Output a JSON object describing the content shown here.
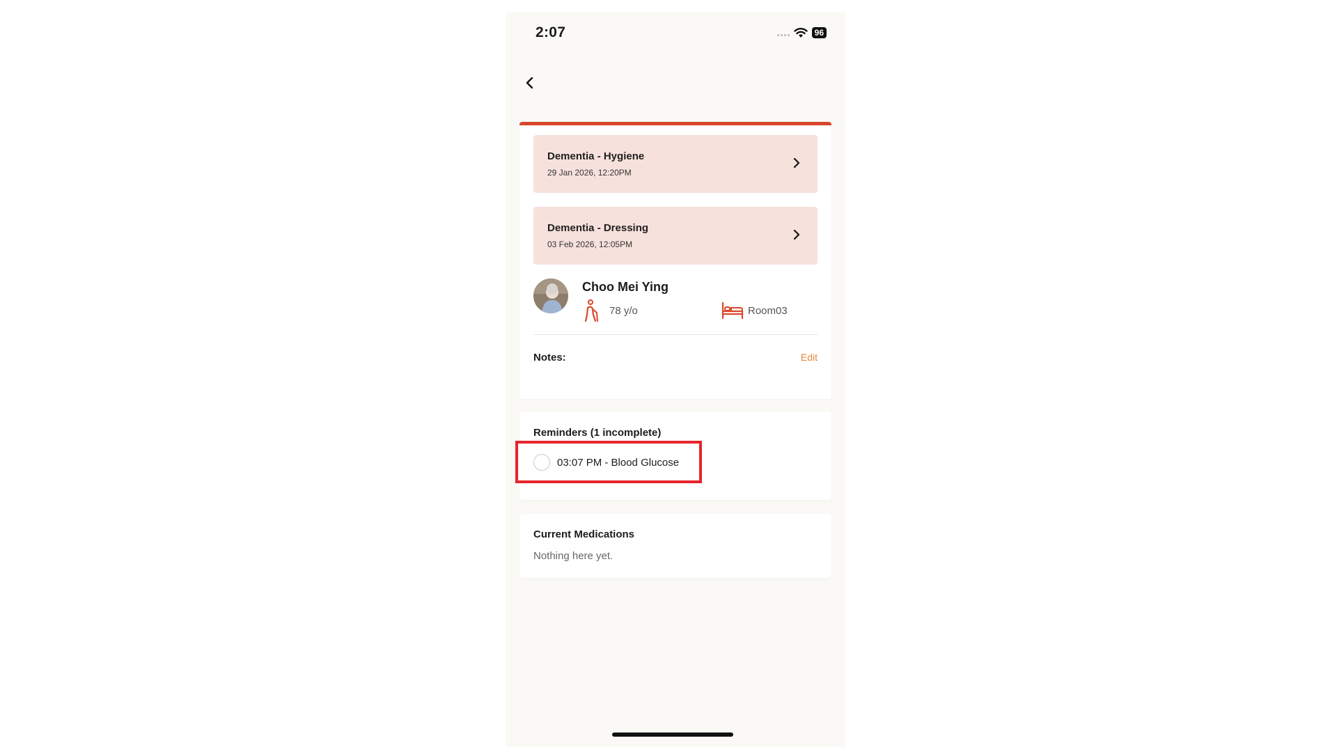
{
  "status_bar": {
    "time": "2:07",
    "battery": "96"
  },
  "care_plans": [
    {
      "title": "Dementia - Hygiene",
      "date": "29 Jan 2026, 12:20PM"
    },
    {
      "title": "Dementia - Dressing",
      "date": "03 Feb 2026, 12:05PM"
    }
  ],
  "patient": {
    "name": "Choo Mei Ying",
    "age": "78 y/o",
    "room": "Room03"
  },
  "notes": {
    "label": "Notes:",
    "edit_label": "Edit"
  },
  "reminders": {
    "title": "Reminders (1 incomplete)",
    "items": [
      {
        "label": "03:07 PM - Blood Glucose",
        "completed": false
      }
    ]
  },
  "medications": {
    "title": "Current Medications",
    "empty_text": "Nothing here yet."
  },
  "colors": {
    "accent": "#d9472b",
    "plan_bg": "#f7e1dc",
    "edit": "#e8893e",
    "highlight": "#e8242b",
    "background": "#faf9f6"
  }
}
